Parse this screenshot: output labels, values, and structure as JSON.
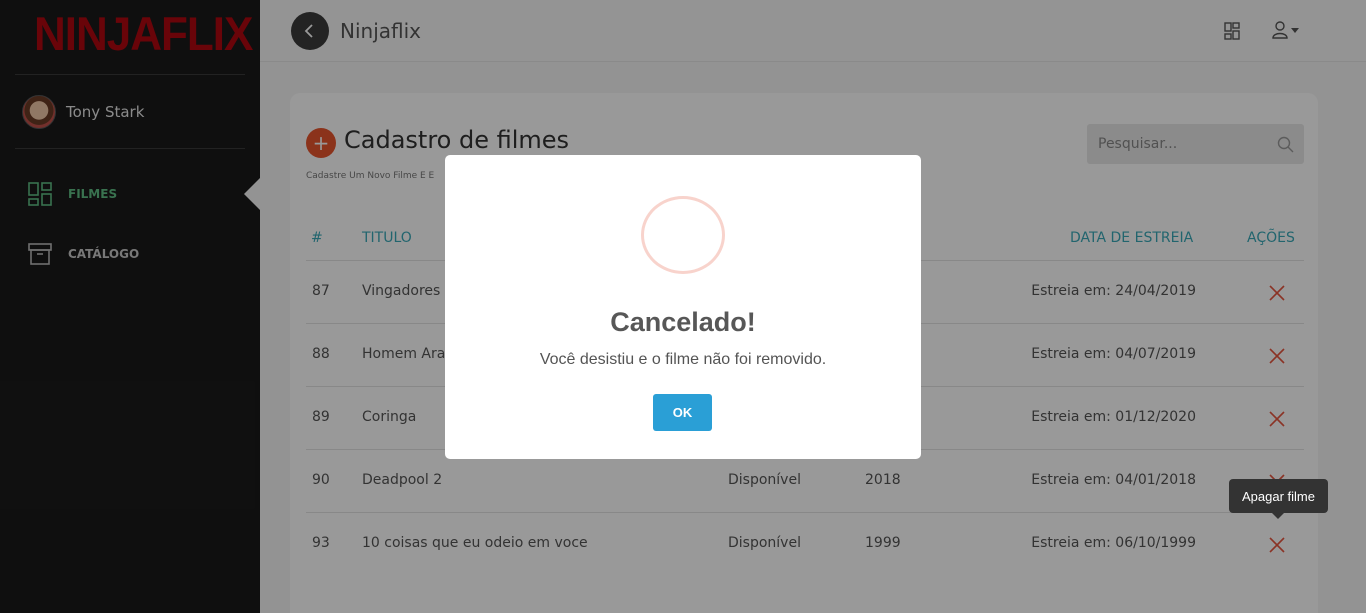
{
  "sidebar": {
    "logo": "NINJAFLIX",
    "user_name": "Tony Stark",
    "items": [
      {
        "label": "FILMES",
        "icon": "dashboard-icon",
        "active": true
      },
      {
        "label": "CATÁLOGO",
        "icon": "archive-box-icon",
        "active": false
      }
    ]
  },
  "topbar": {
    "title": "Ninjaflix"
  },
  "page": {
    "title": "Cadastro de filmes",
    "subtitle": "Cadastre Um Novo Filme E E",
    "search_placeholder": "Pesquisar..."
  },
  "table": {
    "headers": {
      "id": "#",
      "title": "TITULO",
      "release": "DATA DE ESTREIA",
      "actions": "AÇÕES"
    },
    "rows": [
      {
        "id": "87",
        "title": "Vingadores",
        "status": "",
        "year": "",
        "release": "Estreia em: 24/04/2019"
      },
      {
        "id": "88",
        "title": "Homem Ara",
        "status": "",
        "year": "",
        "release": "Estreia em: 04/07/2019"
      },
      {
        "id": "89",
        "title": "Coringa",
        "status": "",
        "year": "",
        "release": "Estreia em: 01/12/2020"
      },
      {
        "id": "90",
        "title": "Deadpool 2",
        "status": "Disponível",
        "year": "2018",
        "release": "Estreia em: 04/01/2018"
      },
      {
        "id": "93",
        "title": "10 coisas que eu odeio em voce",
        "status": "Disponível",
        "year": "1999",
        "release": "Estreia em: 06/10/1999"
      }
    ]
  },
  "modal": {
    "title": "Cancelado!",
    "text": "Você desistiu e o filme não foi removido.",
    "ok_label": "OK"
  },
  "tooltip": {
    "text": "Apagar filme"
  },
  "colors": {
    "brand": "#b00710",
    "accent_green": "#5fbf84",
    "header_teal": "#3aa9b8",
    "delete_red": "#e8553e",
    "ok_blue": "#2a9fd6"
  }
}
